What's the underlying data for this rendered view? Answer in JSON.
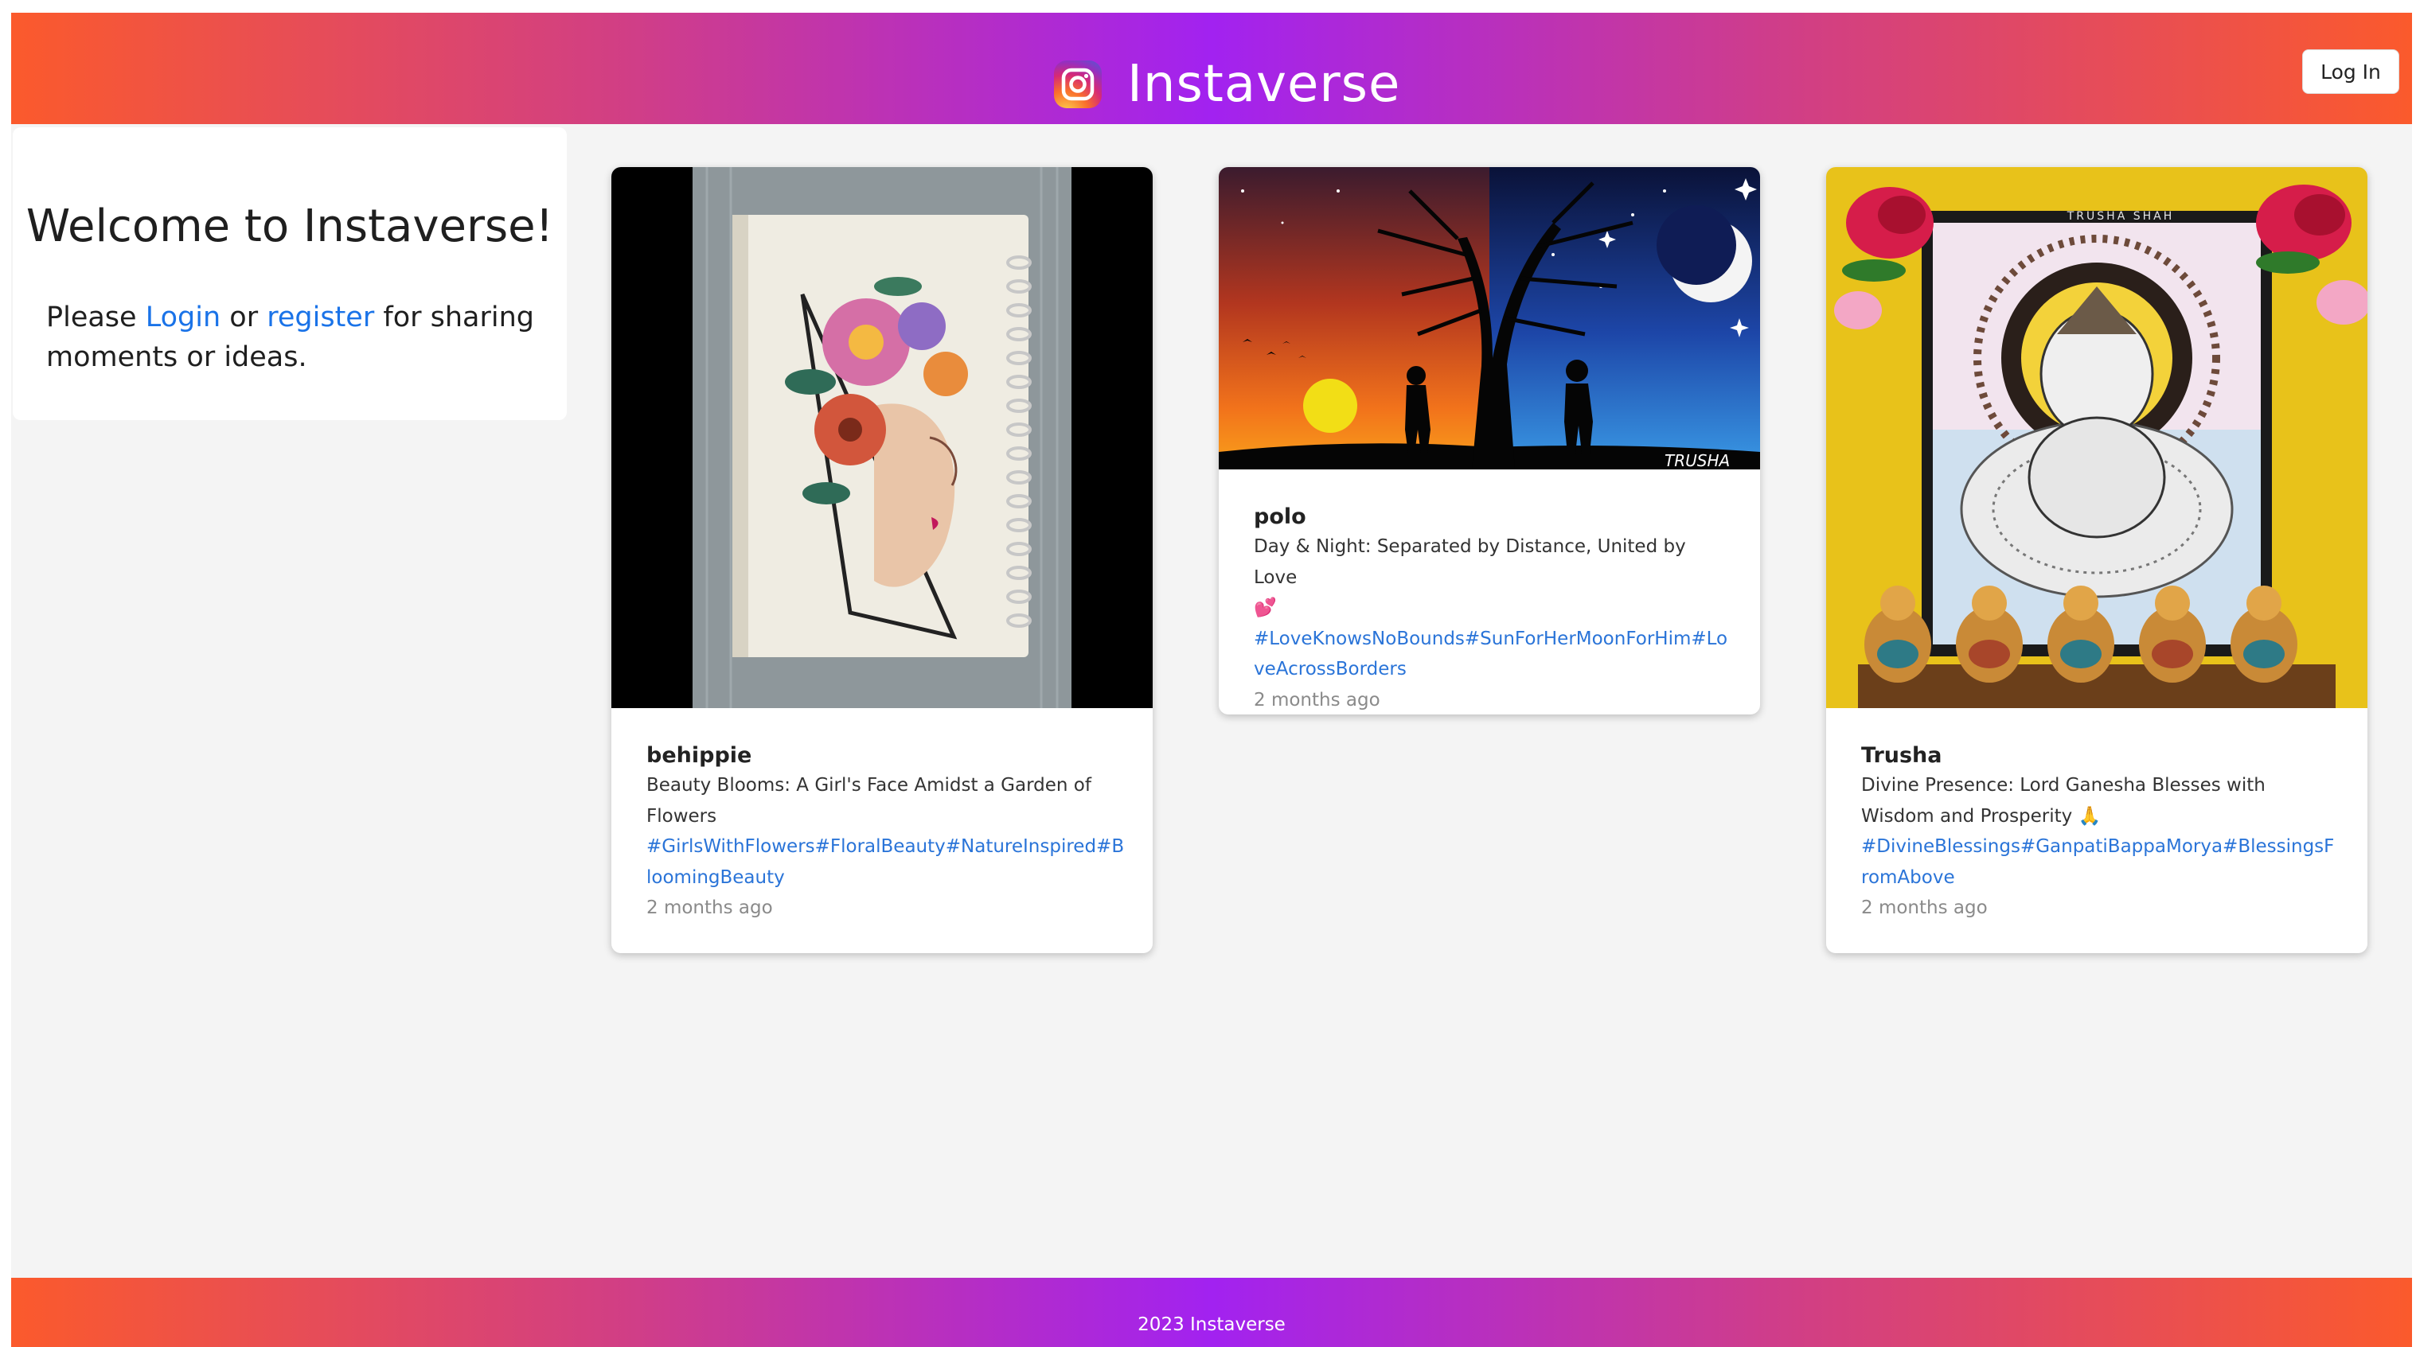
{
  "header": {
    "brand_icon": "instagram-logo-icon",
    "title": "Instaverse",
    "login_label": "Log In"
  },
  "welcome": {
    "title": "Welcome to Instaverse!",
    "text_before": "Please",
    "login_link": "Login",
    "text_or": "or",
    "register_link": "register",
    "text_after": "for sharing moments or ideas."
  },
  "posts": [
    {
      "user": "behippie",
      "caption": "Beauty Blooms: A Girl's Face Amidst a Garden of Flowers",
      "tags": "#GirlsWithFlowers#FloralBeauty#NatureInspired#BloomingBeauty",
      "time": "2 months ago",
      "image": "sketchbook-girl-with-flowers"
    },
    {
      "user": "polo",
      "caption": "Day & Night: Separated by Distance, United by Love",
      "emoji": "💕",
      "tags": "#LoveKnowsNoBounds#SunForHerMoonForHim#LoveAcrossBorders",
      "time": "2 months ago",
      "image": "day-night-tree-silhouette",
      "signature": "TRUSHA"
    },
    {
      "user": "Trusha",
      "caption": "Divine Presence: Lord Ganesha Blesses with Wisdom and Prosperity",
      "emoji": "🙏",
      "tags": "#DivineBlessings#GanpatiBappaMorya#BlessingsFromAbove",
      "time": "2 months ago",
      "image": "ganesha-mandala-art",
      "signature": "TRUSHA SHAH"
    }
  ],
  "footer": {
    "text": "2023 Instaverse"
  }
}
